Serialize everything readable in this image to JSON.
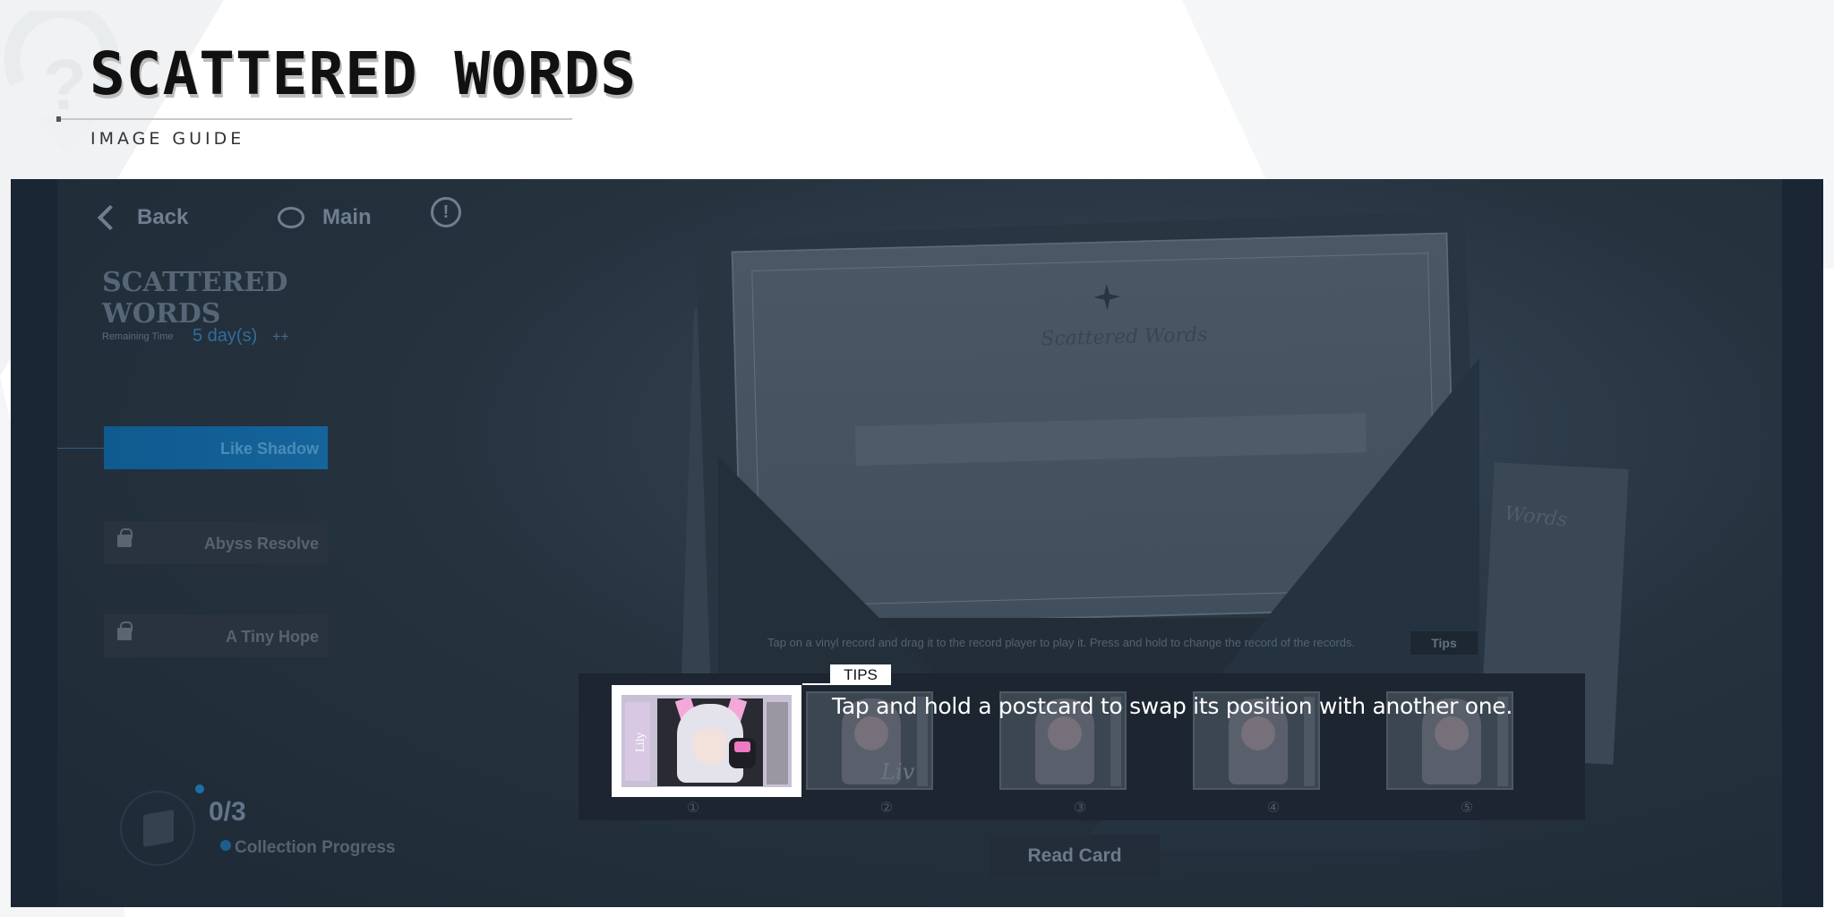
{
  "guide": {
    "title": "SCATTERED WORDS",
    "subtitle": "IMAGE GUIDE"
  },
  "nav": {
    "back_label": "Back",
    "main_label": "Main",
    "info_symbol": "!"
  },
  "event": {
    "title": "SCATTERED WORDS",
    "remaining_label": "Remaining Time",
    "remaining_value": "5 day(s)",
    "remaining_extra": "++"
  },
  "chapters": [
    {
      "label": "Like Shadow",
      "state": "active"
    },
    {
      "label": "Abyss Resolve",
      "state": "locked"
    },
    {
      "label": "A Tiny Hope",
      "state": "locked"
    }
  ],
  "collection": {
    "count": "0/3",
    "label": "Collection Progress"
  },
  "letter": {
    "script_text": "Scattered Words",
    "side_script": "Words"
  },
  "hint": {
    "text": "Tap on a vinyl record and drag it to the record player to play it. Press and hold to change the record of the records.",
    "tips_button": "Tips"
  },
  "postcards": {
    "numbers": [
      "①",
      "②",
      "③",
      "④",
      "⑤"
    ],
    "highlight_side_text": "Lily",
    "card2_signature": "Liv"
  },
  "tips": {
    "tag": "TIPS",
    "text": "Tap and hold a postcard to swap its position with another one."
  },
  "read_card_label": "Read Card",
  "colors": {
    "accent_blue": "#15649b",
    "highlight_border": "#ffffff",
    "background_dark": "#1c2937"
  }
}
